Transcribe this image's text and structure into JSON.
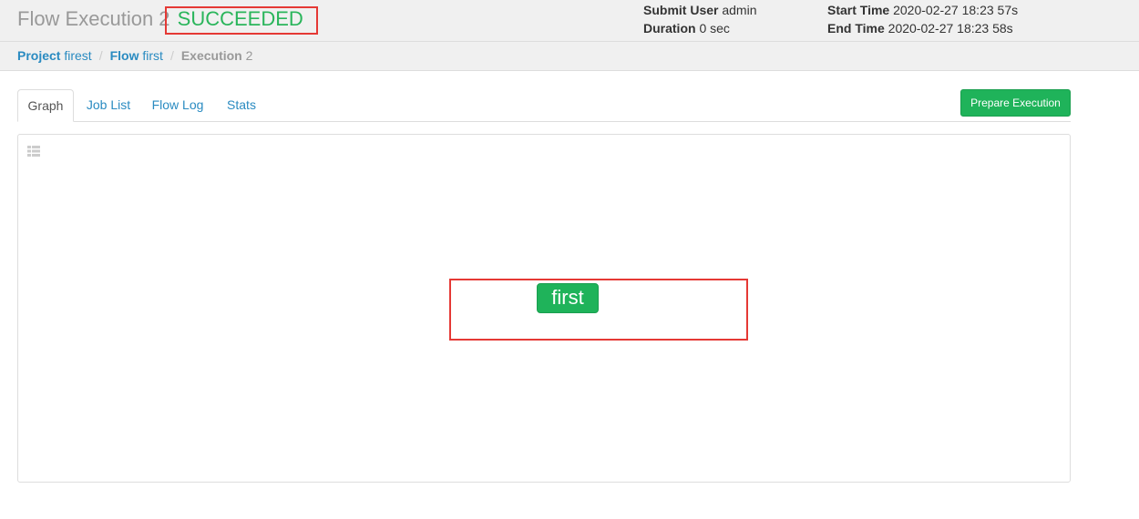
{
  "header": {
    "title": "Flow Execution 2",
    "status": "SUCCEEDED",
    "submit_user_label": "Submit User",
    "submit_user_value": "admin",
    "duration_label": "Duration",
    "duration_value": "0 sec",
    "start_time_label": "Start Time",
    "start_time_value": "2020-02-27 18:23 57s",
    "end_time_label": "End Time",
    "end_time_value": "2020-02-27 18:23 58s"
  },
  "breadcrumb": {
    "project_label": "Project",
    "project_value": "firest",
    "flow_label": "Flow",
    "flow_value": "first",
    "execution_label": "Execution",
    "execution_value": "2",
    "separator": "/"
  },
  "tabs": [
    {
      "label": "Graph",
      "active": true
    },
    {
      "label": "Job List",
      "active": false
    },
    {
      "label": "Flow Log",
      "active": false
    },
    {
      "label": "Stats",
      "active": false
    }
  ],
  "actions": {
    "prepare_execution_label": "Prepare Execution"
  },
  "graph": {
    "toggle_icon": "panel-toggle-icon",
    "nodes": [
      {
        "label": "first",
        "status": "SUCCEEDED"
      }
    ]
  },
  "colors": {
    "success": "#1fb35a",
    "link": "#2a8bc1",
    "highlight": "#e53935"
  }
}
